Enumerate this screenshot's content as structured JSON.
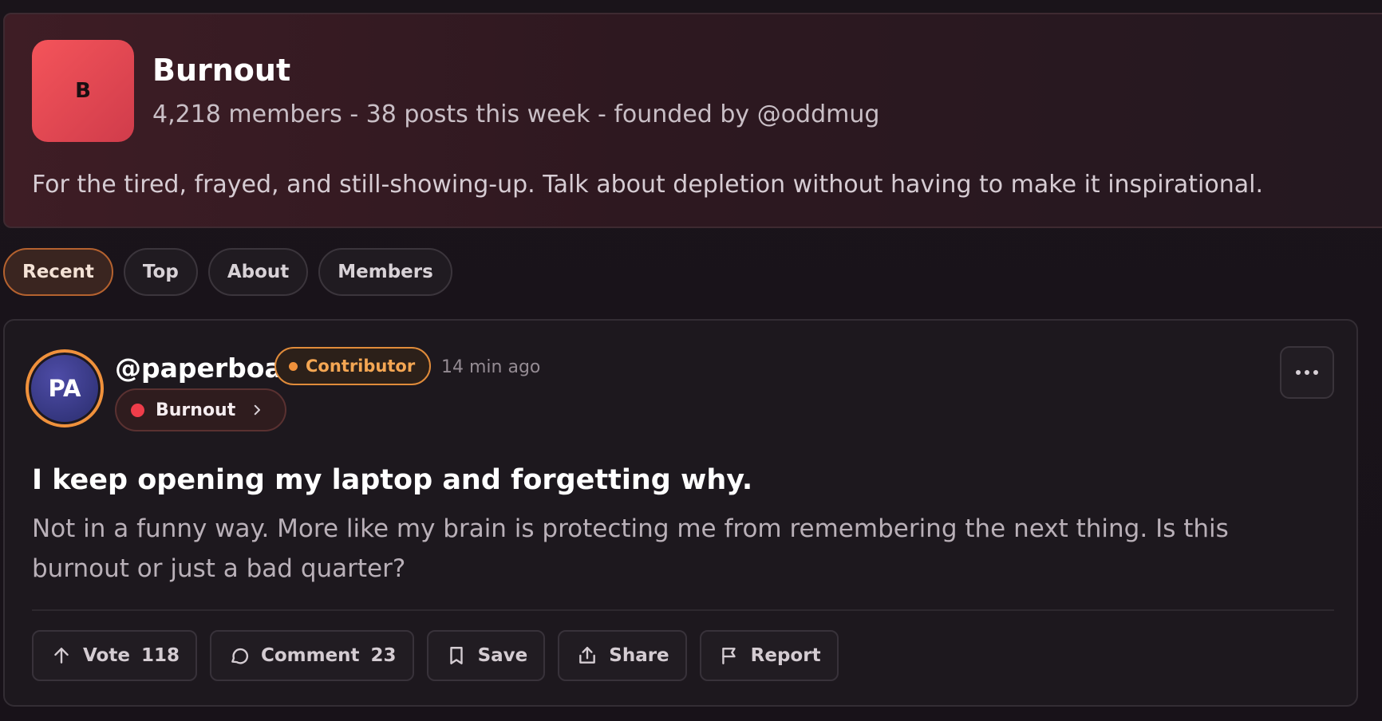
{
  "community": {
    "logo_letter": "B",
    "name": "Burnout",
    "meta": "4,218 members - 38 posts this week - founded by @oddmug",
    "description": "For the tired, frayed, and still-showing-up. Talk about depletion without having to make it inspirational."
  },
  "tabs": [
    {
      "label": "Recent",
      "active": true
    },
    {
      "label": "Top",
      "active": false
    },
    {
      "label": "About",
      "active": false
    },
    {
      "label": "Members",
      "active": false
    }
  ],
  "post": {
    "author": {
      "initials": "PA",
      "username": "@paperboat",
      "role": "Contributor"
    },
    "timestamp": "14 min ago",
    "community_chip": "Burnout",
    "title": "I keep opening my laptop and forgetting why.",
    "body": "Not in a funny way. More like my brain is protecting me from remembering the next thing. Is this burnout or just a bad quarter?",
    "actions": {
      "vote_label": "Vote",
      "vote_count": "118",
      "comment_label": "Comment",
      "comment_count": "23",
      "save_label": "Save",
      "share_label": "Share",
      "report_label": "Report"
    }
  },
  "colors": {
    "accent_orange": "#f0913b",
    "logo_red": "#f4545a",
    "community_dot": "#ef3d4a"
  },
  "icons": [
    "arrow-up-icon",
    "comment-icon",
    "bookmark-icon",
    "share-icon",
    "flag-icon",
    "more-icon",
    "chevron-right-icon"
  ]
}
